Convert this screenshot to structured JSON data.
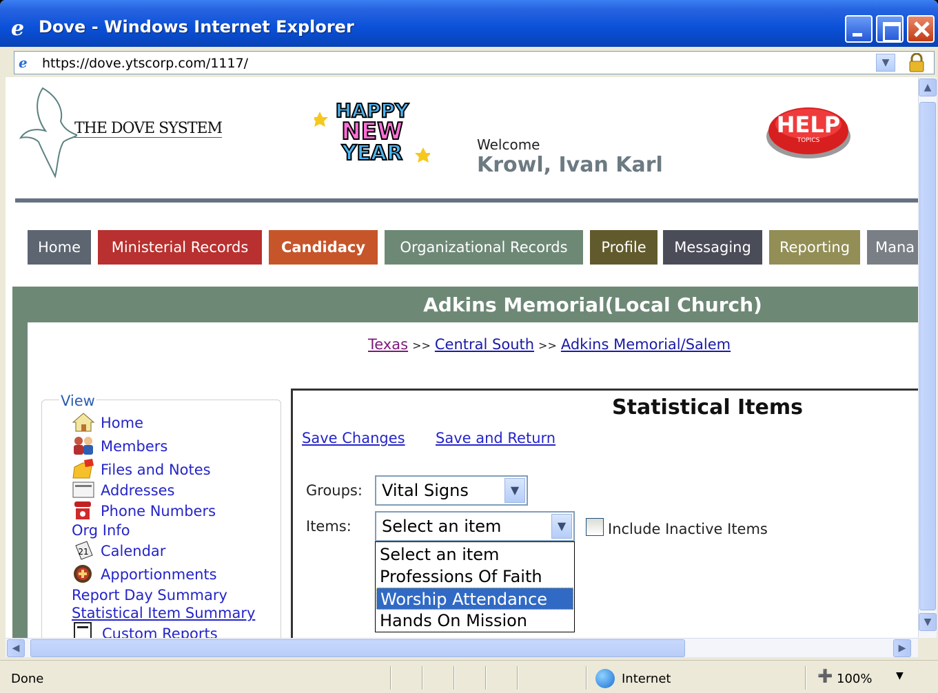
{
  "window": {
    "title": "Dove - Windows Internet Explorer",
    "url": "https://dove.ytscorp.com/1117/"
  },
  "header": {
    "logo_text": "THE DOVE SYSTEM",
    "banner_lines": [
      "HAPPY",
      "NEW",
      "YEAR"
    ],
    "welcome_label": "Welcome",
    "user_name": "Krowl, Ivan Karl",
    "help_button": {
      "top": "HELP",
      "bottom": "TOPICS"
    }
  },
  "nav": {
    "tabs": [
      {
        "label": "Home",
        "color": "#5c6570"
      },
      {
        "label": "Ministerial Records",
        "color": "#b8302f"
      },
      {
        "label": "Candidacy",
        "color": "#c7552a"
      },
      {
        "label": "Organizational Records",
        "color": "#6e8876"
      },
      {
        "label": "Profile",
        "color": "#615a2c"
      },
      {
        "label": "Messaging",
        "color": "#4a4c58"
      },
      {
        "label": "Reporting",
        "color": "#928e55"
      },
      {
        "label": "Mana",
        "color": "#7a7f86"
      }
    ]
  },
  "org": {
    "title": "Adkins Memorial(Local Church)",
    "breadcrumb": [
      {
        "label": "Texas",
        "visited": true
      },
      {
        "label": "Central South",
        "visited": false
      },
      {
        "label": "Adkins Memorial/Salem",
        "visited": false
      }
    ],
    "separator": ">>"
  },
  "sidebar": {
    "legend": "View",
    "items": [
      {
        "label": "Home",
        "icon": "house-icon"
      },
      {
        "label": "Members",
        "icon": "people-icon"
      },
      {
        "label": "Files and Notes",
        "icon": "folder-icon"
      },
      {
        "label": "Addresses",
        "icon": "envelope-icon"
      },
      {
        "label": "Phone Numbers",
        "icon": "telephone-icon"
      },
      {
        "label": "Org Info",
        "icon": ""
      },
      {
        "label": "Calendar",
        "icon": "calendar-icon"
      },
      {
        "label": "Apportionments",
        "icon": "coin-icon"
      },
      {
        "label": "Report Day Summary",
        "icon": ""
      },
      {
        "label": "Statistical Item Summary",
        "icon": ""
      },
      {
        "label": "Custom Reports",
        "icon": "document-icon"
      }
    ]
  },
  "main": {
    "title": "Statistical Items",
    "save_changes": "Save Changes",
    "save_return": "Save and Return",
    "groups_label": "Groups:",
    "groups_value": "Vital Signs",
    "items_label": "Items:",
    "items_value": "Select an item",
    "items_options": [
      "Select an item",
      "Professions Of Faith",
      "Worship Attendance",
      "Hands On Mission"
    ],
    "highlighted_option": "Worship Attendance",
    "include_inactive_label": "Include Inactive Items",
    "include_inactive_checked": false
  },
  "status": {
    "text": "Done",
    "zone": "Internet",
    "zoom": "100%"
  }
}
